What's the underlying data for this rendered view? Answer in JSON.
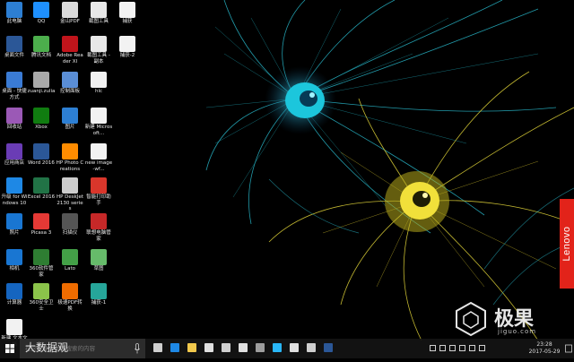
{
  "desktop": {
    "icons": [
      {
        "label": "此电脑",
        "icon": "monitor-icon",
        "color": "#2d7fd3"
      },
      {
        "label": "QQ",
        "icon": "qq-penguin-icon",
        "color": "#1e90ff"
      },
      {
        "label": "金山PDF",
        "icon": "pdf-doc-icon",
        "color": "#d9d9d9"
      },
      {
        "label": "截图工具",
        "icon": "snipping-tool-icon",
        "color": "#e8e8e8"
      },
      {
        "label": "捕获",
        "icon": "blank-file-icon",
        "color": "#f2f2f2"
      },
      {
        "label": "桌面文件",
        "icon": "word-doc-icon",
        "color": "#2b5797"
      },
      {
        "label": "腾讯文档",
        "icon": "tencent-app-icon",
        "color": "#4cae4c"
      },
      {
        "label": "Adobe Reader XI",
        "icon": "adobe-reader-icon",
        "color": "#c0141b"
      },
      {
        "label": "截图工具 - 副本",
        "icon": "snipping-copy-icon",
        "color": "#e8e8e8"
      },
      {
        "label": "捕获-2",
        "icon": "image-file-icon",
        "color": "#f2f2f2"
      },
      {
        "label": "桌面 - 快捷方式",
        "icon": "network-icon",
        "color": "#3a7bd5"
      },
      {
        "label": "zuanji.zulia",
        "icon": "archive-icon",
        "color": "#aaaaaa"
      },
      {
        "label": "控制面板",
        "icon": "gamepad-icon",
        "color": "#5a8ed6"
      },
      {
        "label": "hlc",
        "icon": "text-file-icon",
        "color": "#f2f2f2"
      },
      {
        "label": "回收站",
        "icon": "colorful-app-icon",
        "color": "#9b59b6"
      },
      {
        "label": "Xbox",
        "icon": "xbox-icon",
        "color": "#107c10"
      },
      {
        "label": "图片",
        "icon": "photos-icon",
        "color": "#2d7fd3"
      },
      {
        "label": "新建 Microsoft...",
        "icon": "word-new-icon",
        "color": "#f2f2f2"
      },
      {
        "label": "应用商店",
        "icon": "store-icon",
        "color": "#6a3cb5"
      },
      {
        "label": "Word 2016",
        "icon": "word-icon",
        "color": "#2b5797"
      },
      {
        "label": "HP Photo Creations",
        "icon": "hp-photo-icon",
        "color": "#ff8c00"
      },
      {
        "label": "new image-wf...",
        "icon": "paint-file-icon",
        "color": "#f2f2f2"
      },
      {
        "label": "升级 for Windows 10",
        "icon": "windows-upgrade-icon",
        "color": "#1e88e5"
      },
      {
        "label": "Excel 2016",
        "icon": "excel-icon",
        "color": "#217346"
      },
      {
        "label": "HP DeskJet 2130 series",
        "icon": "printer-icon",
        "color": "#cccccc"
      },
      {
        "label": "智能打印助手",
        "icon": "print-assist-icon",
        "color": "#d9362b"
      },
      {
        "label": "照片",
        "icon": "photo-app-icon",
        "color": "#1976d2"
      },
      {
        "label": "Picasa 3",
        "icon": "picasa-icon",
        "color": "#e53935"
      },
      {
        "label": "扫描仪",
        "icon": "scanner-icon",
        "color": "#555555"
      },
      {
        "label": "联想电脑管家",
        "icon": "lenovo-manager-icon",
        "color": "#c62828"
      },
      {
        "label": "相机",
        "icon": "camera-icon",
        "color": "#1976d2"
      },
      {
        "label": "360软件管家",
        "icon": "software-manager-icon",
        "color": "#2e7d32"
      },
      {
        "label": "Lato",
        "icon": "lato-icon",
        "color": "#43a047"
      },
      {
        "label": "草图",
        "icon": "sketch-icon",
        "color": "#66bb6a"
      },
      {
        "label": "计算器",
        "icon": "calculator-icon",
        "color": "#1565c0"
      },
      {
        "label": "360安全卫士",
        "icon": "security-guard-icon",
        "color": "#8bc34a"
      },
      {
        "label": "极速PDF转换",
        "icon": "pdf-convert-icon",
        "color": "#ef6c00"
      },
      {
        "label": "捕获-1",
        "icon": "image-file-2-icon",
        "color": "#26a69a"
      },
      {
        "label": "新建 文本文档",
        "icon": "text-doc-icon",
        "color": "#f2f2f2"
      }
    ]
  },
  "brand_tab": "Lenovo",
  "watermark": {
    "name": "极果",
    "site": "jiguo.com",
    "search_overlay": "大数据观"
  },
  "taskbar": {
    "search_placeholder": "在这里输入你要搜索的内容",
    "pinned": [
      {
        "icon": "task-view-icon",
        "color": "#cfcfcf"
      },
      {
        "icon": "edge-icon",
        "color": "#1e88e5"
      },
      {
        "icon": "file-explorer-icon",
        "color": "#f2c94c"
      },
      {
        "icon": "store-icon",
        "color": "#e0e0e0"
      },
      {
        "icon": "media-icon",
        "color": "#cfcfcf"
      },
      {
        "icon": "camera-app-icon",
        "color": "#e0e0e0"
      },
      {
        "icon": "window-icon",
        "color": "#9e9e9e"
      },
      {
        "icon": "qq-icon",
        "color": "#29b6f6"
      },
      {
        "icon": "calendar-icon",
        "color": "#e0e0e0"
      },
      {
        "icon": "document-icon",
        "color": "#cfcfcf"
      },
      {
        "icon": "word-app-icon",
        "color": "#2b5797"
      }
    ],
    "tray": [
      {
        "icon": "people-icon"
      },
      {
        "icon": "chevron-up-icon"
      },
      {
        "icon": "network-tray-icon"
      },
      {
        "icon": "volume-icon"
      },
      {
        "icon": "battery-icon"
      },
      {
        "icon": "keyboard-icon"
      }
    ],
    "time": "23:28",
    "date": "2017-05-29"
  }
}
